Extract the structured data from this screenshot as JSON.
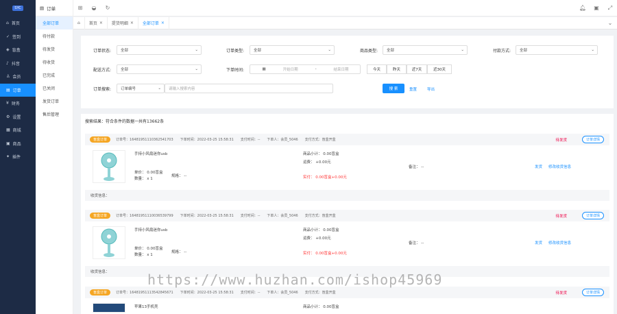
{
  "sidebar": {
    "logo": "SYC",
    "items": [
      {
        "label": "首页"
      },
      {
        "label": "签到"
      },
      {
        "label": "盲盒"
      },
      {
        "label": "抖音"
      },
      {
        "label": "会员"
      },
      {
        "label": "订单"
      },
      {
        "label": "财务"
      },
      {
        "label": "设置"
      },
      {
        "label": "商城"
      },
      {
        "label": "商品"
      },
      {
        "label": "插件"
      }
    ]
  },
  "subnav": {
    "title": "订单",
    "items": [
      "全部订单",
      "待付款",
      "待发货",
      "待收货",
      "已完成",
      "已关闭",
      "发货订单",
      "售后管理"
    ]
  },
  "tabs": [
    "首页",
    "提货明细",
    "全部订单"
  ],
  "filter": {
    "order_status_label": "订单状态:",
    "order_status_value": "全部",
    "order_type_label": "订单类型:",
    "order_type_value": "全部",
    "goods_type_label": "商品类型:",
    "goods_type_value": "全部",
    "pay_method_label": "付款方式:",
    "pay_method_value": "全部",
    "delivery_label": "配送方式:",
    "delivery_value": "全部",
    "order_time_label": "下单时间:",
    "start_date": "开始日期",
    "end_date": "结束日期",
    "quick": [
      "今天",
      "昨天",
      "近7天",
      "近30天"
    ],
    "search_label": "订单搜索:",
    "search_type": "订单编号",
    "search_placeholder": "请输入搜索内容",
    "search_btn": "搜 索",
    "reset": "重置",
    "export": "导出"
  },
  "result": {
    "count_text": "搜索结果：符合条件的数据一共有13662条"
  },
  "orders": [
    {
      "badge": "盲盒订单",
      "order_no_label": "订单号：",
      "order_no": "16481951110362541703",
      "time_label": "下单时间：",
      "time": "2022-03-25 15:58:31",
      "pay_time_label": "支付时间：",
      "pay_time": "--",
      "buyer_label": "下单人：",
      "buyer": "会员_5046",
      "pay_method_label": "支付方式：",
      "pay_method": "盲盒开盒",
      "status": "待发货",
      "detail_btn": "订单详情",
      "goods_name": "手持小风扇迷你usb",
      "unit_price": "单价： 0.00盲盒",
      "qty": "数量： x 1",
      "spec": "规格： --",
      "subtotal": "商品小计： 0.00盲盒",
      "freight": "运费： +0.00元",
      "paid": "实付： 0.00盲盒+0.00元",
      "remark_label": "备注： --",
      "ship": "发货",
      "addr": "修改收货信息",
      "remark": "收货信息："
    },
    {
      "badge": "盲盒订单",
      "order_no_label": "订单号：",
      "order_no": "16481951110036539799",
      "time_label": "下单时间：",
      "time": "2022-03-25 15:58:31",
      "pay_time_label": "支付时间：",
      "pay_time": "--",
      "buyer_label": "下单人：",
      "buyer": "会员_5046",
      "pay_method_label": "支付方式：",
      "pay_method": "盲盒开盒",
      "status": "待发货",
      "detail_btn": "订单详情",
      "goods_name": "手持小风扇迷你usb",
      "unit_price": "单价： 0.00盲盒",
      "qty": "数量： x 1",
      "spec": "规格： --",
      "subtotal": "商品小计： 0.00盲盒",
      "freight": "运费： +0.00元",
      "paid": "实付： 0.00盲盒+0.00元",
      "remark_label": "备注： --",
      "ship": "发货",
      "addr": "修改收货信息",
      "remark": "收货信息："
    },
    {
      "badge": "盲盒订单",
      "order_no_label": "订单号：",
      "order_no": "16481951113542845671",
      "time_label": "下单时间：",
      "time": "2022-03-25 15:58:31",
      "pay_time_label": "支付时间：",
      "pay_time": "--",
      "buyer_label": "下单人：",
      "buyer": "会员_5046",
      "pay_method_label": "支付方式：",
      "pay_method": "盲盒开盒",
      "status": "待发货",
      "detail_btn": "订单详情",
      "goods_name": "苹果13手机壳",
      "subtotal": "商品小计： 0.00盲盒"
    }
  ],
  "watermark": "https://www.huzhan.com/ishop45969"
}
